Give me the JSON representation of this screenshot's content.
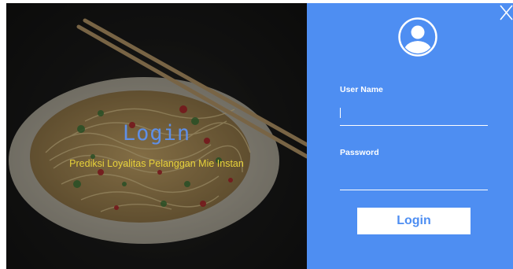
{
  "left": {
    "title": "Login",
    "subtitle": "Prediksi Loyalitas Pelanggan Mie Instan"
  },
  "form": {
    "username_label": "User Name",
    "username_value": "",
    "password_label": "Password",
    "password_value": "",
    "login_label": "Login"
  },
  "icons": {
    "close": "close-icon",
    "avatar": "user-avatar-icon"
  },
  "colors": {
    "panel": "#4e8ef2",
    "title": "#5f8fe6",
    "subtitle": "#e8d23a",
    "button_text": "#4e8ef2"
  }
}
